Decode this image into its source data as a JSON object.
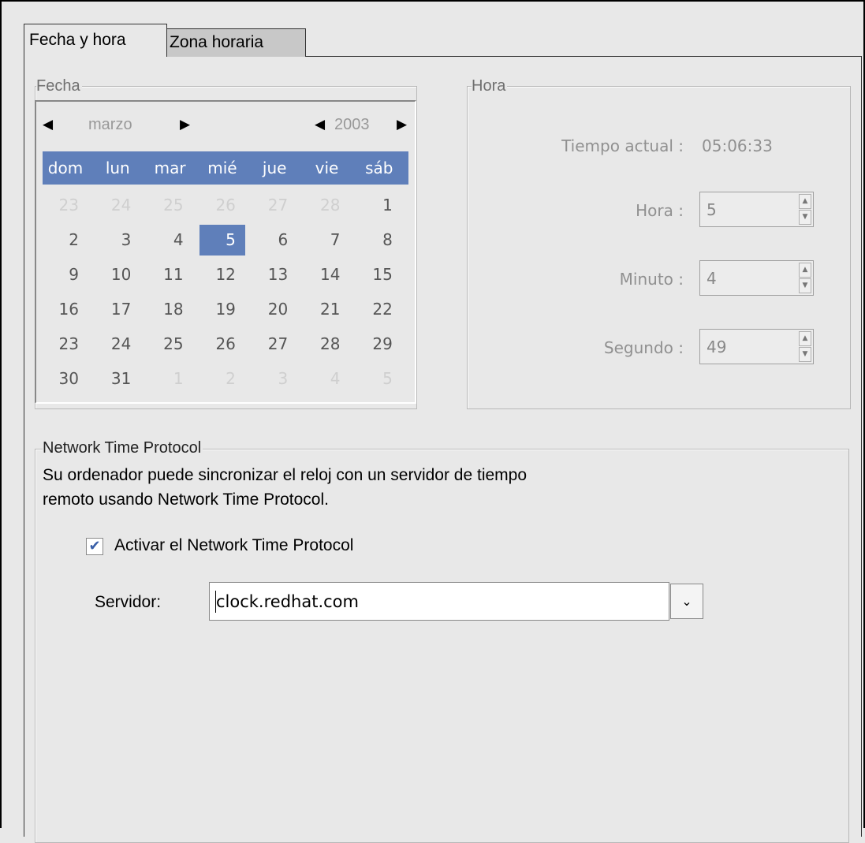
{
  "tabs": [
    {
      "label": "Fecha y hora",
      "active": true
    },
    {
      "label": "Zona horaria",
      "active": false
    }
  ],
  "fecha": {
    "frame_label": "Fecha",
    "month": "marzo",
    "year": "2003",
    "weekdays": [
      "dom",
      "lun",
      "mar",
      "mié",
      "jue",
      "vie",
      "sáb"
    ],
    "weeks": [
      [
        "23",
        "24",
        "25",
        "26",
        "27",
        "28",
        "1"
      ],
      [
        "2",
        "3",
        "4",
        "5",
        "6",
        "7",
        "8"
      ],
      [
        "9",
        "10",
        "11",
        "12",
        "13",
        "14",
        "15"
      ],
      [
        "16",
        "17",
        "18",
        "19",
        "20",
        "21",
        "22"
      ],
      [
        "23",
        "24",
        "25",
        "26",
        "27",
        "28",
        "29"
      ],
      [
        "30",
        "31",
        "1",
        "2",
        "3",
        "4",
        "5"
      ]
    ],
    "selected_day": "5"
  },
  "hora": {
    "frame_label": "Hora",
    "tiempo_actual_label": "Tiempo actual :",
    "tiempo_actual_value": "05:06:33",
    "hora_label": "Hora :",
    "hora_value": "5",
    "minuto_label": "Minuto :",
    "minuto_value": "4",
    "segundo_label": "Segundo :",
    "segundo_value": "49"
  },
  "ntp": {
    "frame_label": "Network Time Protocol",
    "description_line1": "Su ordenador puede sincronizar el reloj con un servidor de tiempo",
    "description_line2": "remoto usando Network Time Protocol.",
    "checkbox_label": "Activar el Network Time Protocol",
    "checkbox_checked": true,
    "servidor_label": "Servidor:",
    "servidor_value": "clock.redhat.com"
  },
  "colors": {
    "selection": "#5f7fba",
    "window_bg": "#e8e8e8"
  }
}
